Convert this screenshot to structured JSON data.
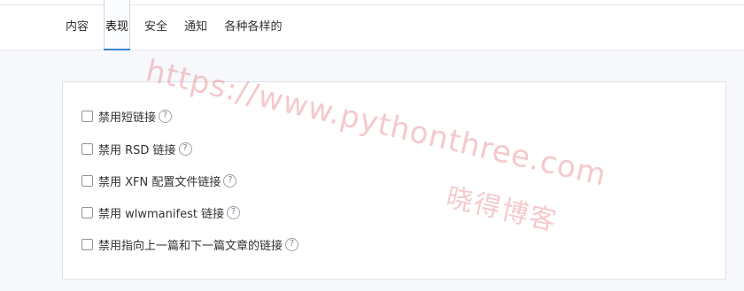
{
  "tabs": [
    {
      "label": "内容"
    },
    {
      "label": "表现"
    },
    {
      "label": "安全"
    },
    {
      "label": "通知"
    },
    {
      "label": "各种各样的"
    }
  ],
  "active_tab": "表现",
  "options": [
    {
      "label": "禁用短链接",
      "checked": false
    },
    {
      "label": "禁用 RSD 链接",
      "checked": false
    },
    {
      "label": "禁用 XFN 配置文件链接",
      "checked": false
    },
    {
      "label": "禁用 wlwmanifest 链接",
      "checked": false
    },
    {
      "label": "禁用指向上一篇和下一篇文章的链接",
      "checked": false
    }
  ],
  "help_glyph": "?",
  "watermark": {
    "url": "https://www.pythonthree.com",
    "name": "晓得博客"
  },
  "colors": {
    "accent": "#3b82d6",
    "watermark": "#e87e84"
  }
}
